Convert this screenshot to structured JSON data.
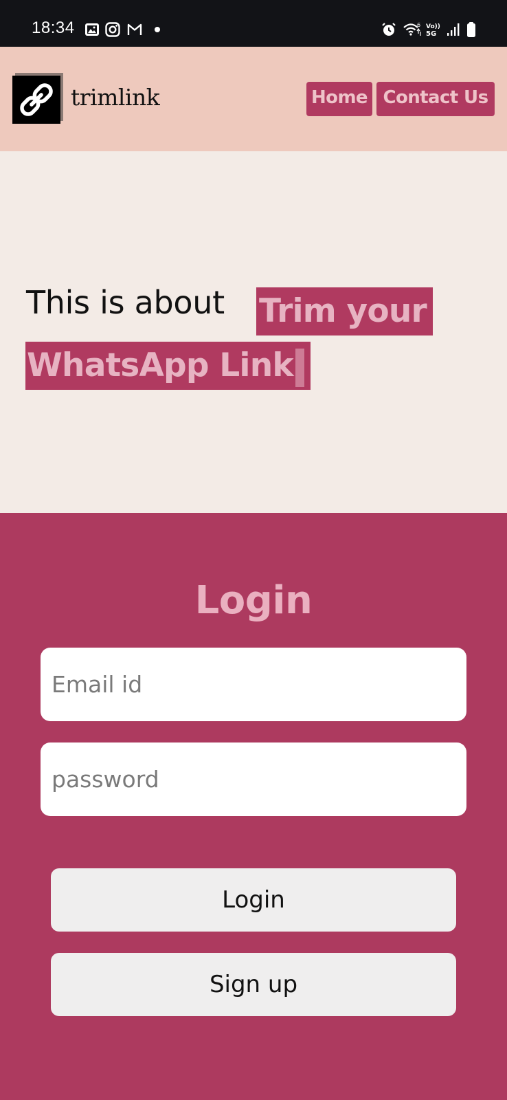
{
  "status_bar": {
    "time": "18:34",
    "left_icons": [
      "gallery-icon",
      "instagram-icon",
      "gmail-icon",
      "notification-dot"
    ],
    "right_icons": [
      "alarm-icon",
      "wifi-icon",
      "volte-5g-icon",
      "signal-icon",
      "battery-icon"
    ],
    "network_label_top": "Vo))",
    "network_label_bottom": "5G"
  },
  "header": {
    "logo_icon": "link-icon",
    "brand": "trimlink",
    "nav": [
      {
        "label": "Home"
      },
      {
        "label": "Contact Us"
      }
    ]
  },
  "hero": {
    "text_plain": "This is about",
    "highlight_line1": "Trim your",
    "highlight_line2": "WhatsApp Link"
  },
  "login": {
    "title": "Login",
    "email_placeholder": "Email id",
    "email_value": "",
    "password_placeholder": "password",
    "password_value": "",
    "login_button": "Login",
    "signup_button": "Sign up"
  },
  "colors": {
    "status_bar_bg": "#121317",
    "header_bg": "#eec9bd",
    "accent": "#b03a60",
    "accent_text": "#e7b3c2",
    "hero_bg": "#f3ebe6",
    "login_bg": "#ad3a5f",
    "button_bg": "#efeeee"
  }
}
